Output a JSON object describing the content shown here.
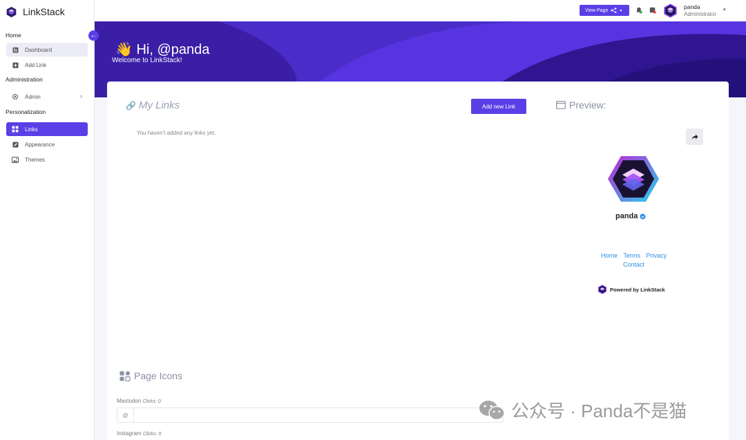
{
  "brand": {
    "name": "LinkStack"
  },
  "sidebar": {
    "sections": [
      {
        "title": "Home"
      },
      {
        "title": "Administration"
      },
      {
        "title": "Personalization"
      }
    ],
    "items": [
      {
        "label": "Dashboard",
        "icon": "dashboard-icon"
      },
      {
        "label": "Add Link",
        "icon": "add-square-icon"
      },
      {
        "label": "Admin",
        "icon": "gear-icon"
      },
      {
        "label": "Links",
        "icon": "grid-icon",
        "active": true
      },
      {
        "label": "Appearance",
        "icon": "pencil-square-icon"
      },
      {
        "label": "Themes",
        "icon": "image-icon"
      }
    ]
  },
  "topbar": {
    "view_page": "View Page",
    "user": {
      "name": "panda",
      "role": "Administrator"
    }
  },
  "banner": {
    "greeting": "Hi, @panda",
    "welcome": "Welcome to LinkStack!"
  },
  "links_panel": {
    "title": "My Links",
    "add_button": "Add new Link",
    "empty_message": "You haven’t added any links yet."
  },
  "preview": {
    "title": "Preview:",
    "name": "panda",
    "footer_links": [
      "Home",
      "Terms",
      "Privacy",
      "Contact"
    ],
    "powered_by": "Powered by LinkStack"
  },
  "page_icons": {
    "title": "Page Icons",
    "fields": [
      {
        "name": "Mastodon",
        "clicks": "Clicks: 0",
        "addon": "@"
      },
      {
        "name": "Instagram",
        "clicks": "Clicks: 0"
      }
    ]
  },
  "watermark": {
    "text": "公众号 · Panda不是猫"
  },
  "colors": {
    "accent": "#5b3fe6",
    "banner": "#3b1fa8",
    "link": "#2b8ee8"
  }
}
